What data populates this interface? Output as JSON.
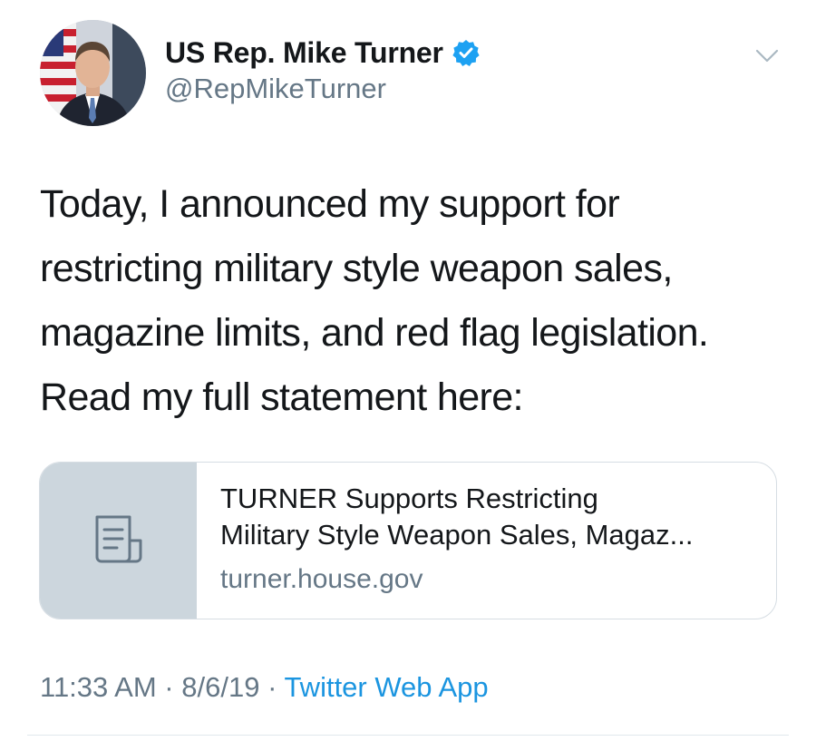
{
  "user": {
    "display_name": "US Rep. Mike Turner",
    "handle": "@RepMikeTurner",
    "verified": true
  },
  "tweet": {
    "text": "Today, I announced my support for\nrestricting military style weapon sales,\nmagazine limits, and red flag legislation.\nRead my full statement here:"
  },
  "link_card": {
    "title": "TURNER Supports Restricting\nMilitary Style Weapon Sales, Magaz...",
    "domain": "turner.house.gov",
    "thumbnail_icon": "document-icon"
  },
  "meta": {
    "time": "11:33 AM",
    "sep1": " · ",
    "date": "8/6/19",
    "sep2": " · ",
    "source": "Twitter Web App"
  },
  "colors": {
    "accent": "#1b95e0",
    "verified_badge": "#1da1f2",
    "secondary_text": "#657786",
    "card_thumb_bg": "#ccd6dd"
  }
}
